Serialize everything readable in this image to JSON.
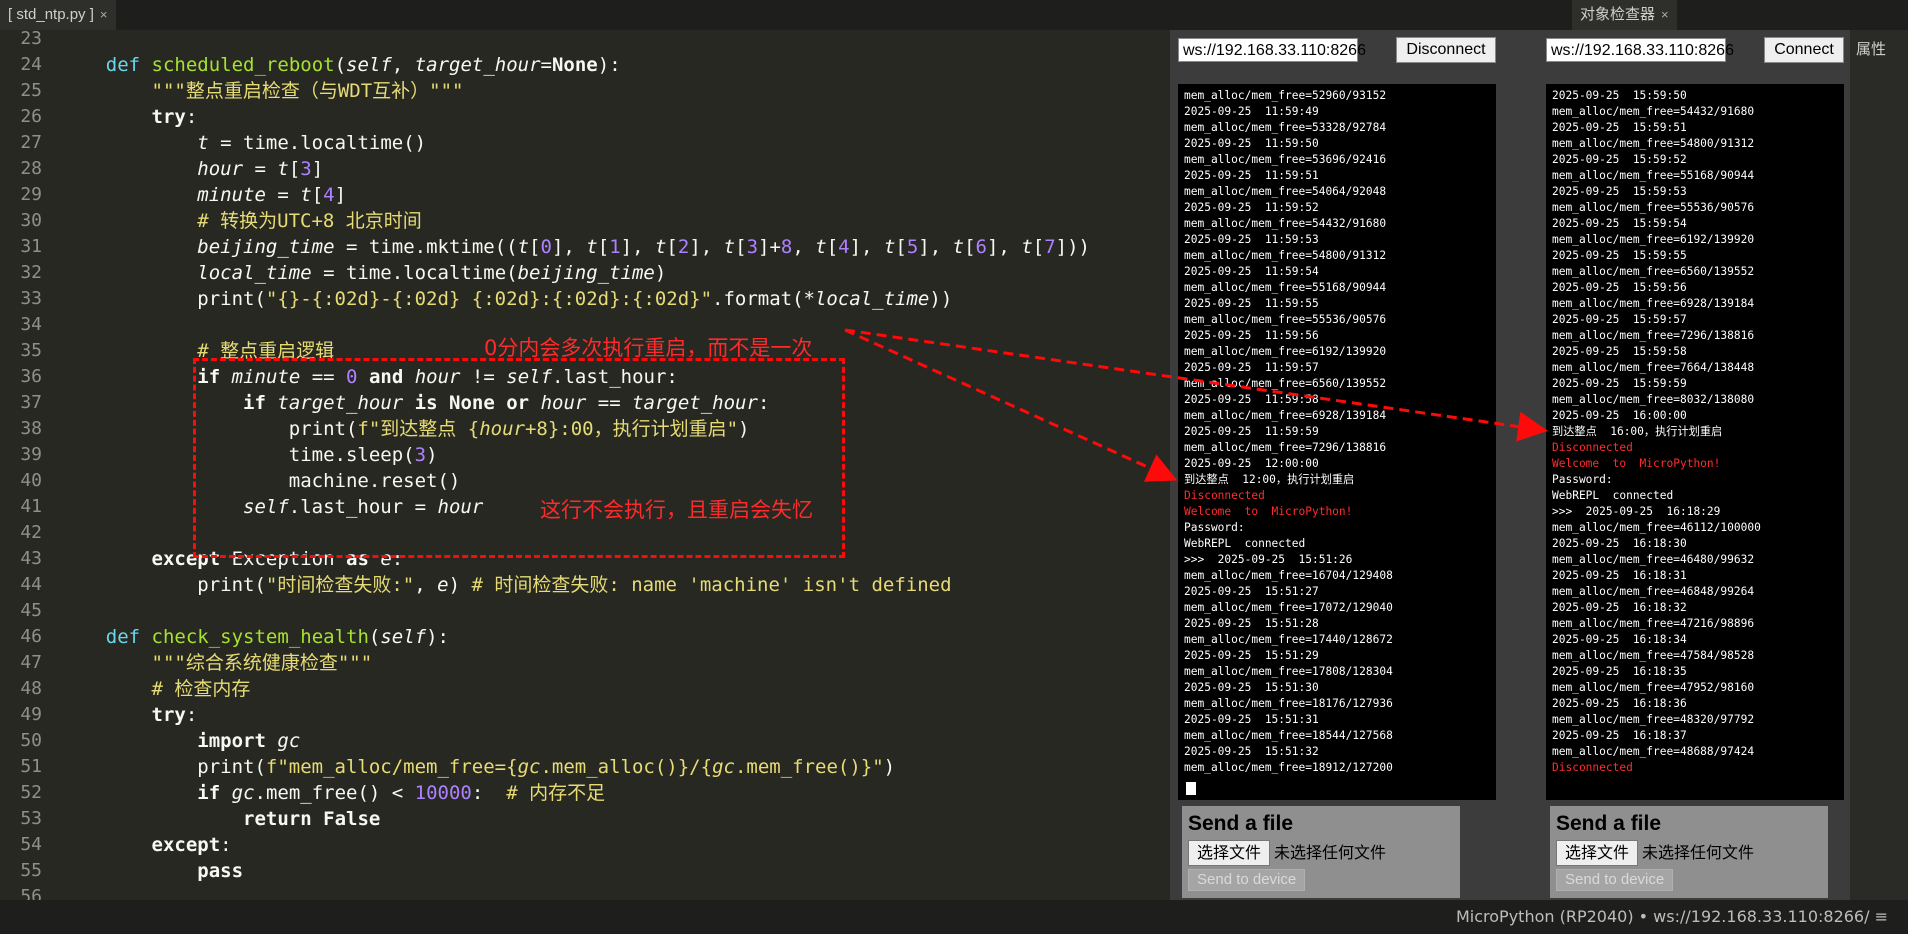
{
  "tabs": {
    "editor_tab": "std_ntp.py",
    "inspector_tab": "对象检查器",
    "properties_tab": "属性"
  },
  "editor": {
    "line_numbers": [
      "23",
      "24",
      "25",
      "26",
      "27",
      "28",
      "29",
      "30",
      "31",
      "32",
      "33",
      "34",
      "35",
      "36",
      "37",
      "38",
      "39",
      "40",
      "41",
      "42",
      "43",
      "44",
      "45",
      "46",
      "47",
      "48",
      "49",
      "50",
      "51",
      "52",
      "53",
      "54",
      "55",
      "56"
    ]
  },
  "annotations": {
    "a1": "0分内会多次执行重启，而不是一次",
    "a2": "这行不会执行，且重启会失忆"
  },
  "webrepl_left": {
    "url": "ws://192.168.33.110:8266",
    "button": "Disconnect",
    "lines": [
      "mem_alloc/mem_free=52960/93152",
      "2025-09-25  11:59:49",
      "mem_alloc/mem_free=53328/92784",
      "2025-09-25  11:59:50",
      "mem_alloc/mem_free=53696/92416",
      "2025-09-25  11:59:51",
      "mem_alloc/mem_free=54064/92048",
      "2025-09-25  11:59:52",
      "mem_alloc/mem_free=54432/91680",
      "2025-09-25  11:59:53",
      "mem_alloc/mem_free=54800/91312",
      "2025-09-25  11:59:54",
      "mem_alloc/mem_free=55168/90944",
      "2025-09-25  11:59:55",
      "mem_alloc/mem_free=55536/90576",
      "2025-09-25  11:59:56",
      "mem_alloc/mem_free=6192/139920",
      "2025-09-25  11:59:57",
      "mem_alloc/mem_free=6560/139552",
      "2025-09-25  11:59:58",
      "mem_alloc/mem_free=6928/139184",
      "2025-09-25  11:59:59",
      "mem_alloc/mem_free=7296/138816",
      "2025-09-25  12:00:00",
      "到达整点  12:00，执行计划重启",
      "Disconnected",
      "Welcome  to  MicroPython!",
      "Password:",
      "WebREPL  connected",
      ">>>  2025-09-25  15:51:26",
      "mem_alloc/mem_free=16704/129408",
      "2025-09-25  15:51:27",
      "mem_alloc/mem_free=17072/129040",
      "2025-09-25  15:51:28",
      "mem_alloc/mem_free=17440/128672",
      "2025-09-25  15:51:29",
      "mem_alloc/mem_free=17808/128304",
      "2025-09-25  15:51:30",
      "mem_alloc/mem_free=18176/127936",
      "2025-09-25  15:51:31",
      "mem_alloc/mem_free=18544/127568",
      "2025-09-25  15:51:32",
      "mem_alloc/mem_free=18912/127200"
    ],
    "send_title": "Send a file",
    "choose_file": "选择文件",
    "no_file": "未选择任何文件",
    "send_button": "Send to device"
  },
  "webrepl_right": {
    "url": "ws://192.168.33.110:8266",
    "button": "Connect",
    "lines": [
      "2025-09-25  15:59:50",
      "mem_alloc/mem_free=54432/91680",
      "2025-09-25  15:59:51",
      "mem_alloc/mem_free=54800/91312",
      "2025-09-25  15:59:52",
      "mem_alloc/mem_free=55168/90944",
      "2025-09-25  15:59:53",
      "mem_alloc/mem_free=55536/90576",
      "2025-09-25  15:59:54",
      "mem_alloc/mem_free=6192/139920",
      "2025-09-25  15:59:55",
      "mem_alloc/mem_free=6560/139552",
      "2025-09-25  15:59:56",
      "mem_alloc/mem_free=6928/139184",
      "2025-09-25  15:59:57",
      "mem_alloc/mem_free=7296/138816",
      "2025-09-25  15:59:58",
      "mem_alloc/mem_free=7664/138448",
      "2025-09-25  15:59:59",
      "mem_alloc/mem_free=8032/138080",
      "2025-09-25  16:00:00",
      "到达整点  16:00，执行计划重启",
      "Disconnected",
      "Welcome  to  MicroPython!",
      "Password:",
      "WebREPL  connected",
      ">>>  2025-09-25  16:18:29",
      "mem_alloc/mem_free=46112/100000",
      "2025-09-25  16:18:30",
      "mem_alloc/mem_free=46480/99632",
      "2025-09-25  16:18:31",
      "mem_alloc/mem_free=46848/99264",
      "2025-09-25  16:18:32",
      "mem_alloc/mem_free=47216/98896",
      "2025-09-25  16:18:34",
      "mem_alloc/mem_free=47584/98528",
      "2025-09-25  16:18:35",
      "mem_alloc/mem_free=47952/98160",
      "2025-09-25  16:18:36",
      "mem_alloc/mem_free=48320/97792",
      "2025-09-25  16:18:37",
      "mem_alloc/mem_free=48688/97424",
      "Disconnected"
    ],
    "send_title": "Send a file",
    "choose_file": "选择文件",
    "no_file": "未选择任何文件",
    "send_button": "Send to device"
  },
  "statusbar": {
    "text": "MicroPython (RP2040)  •  ws://192.168.33.110:8266/  ≡"
  },
  "colors": {
    "background": "#272822",
    "annotation": "#ff0a0a",
    "terminal": "#000000",
    "terminal_error": "#ff2b2b"
  }
}
